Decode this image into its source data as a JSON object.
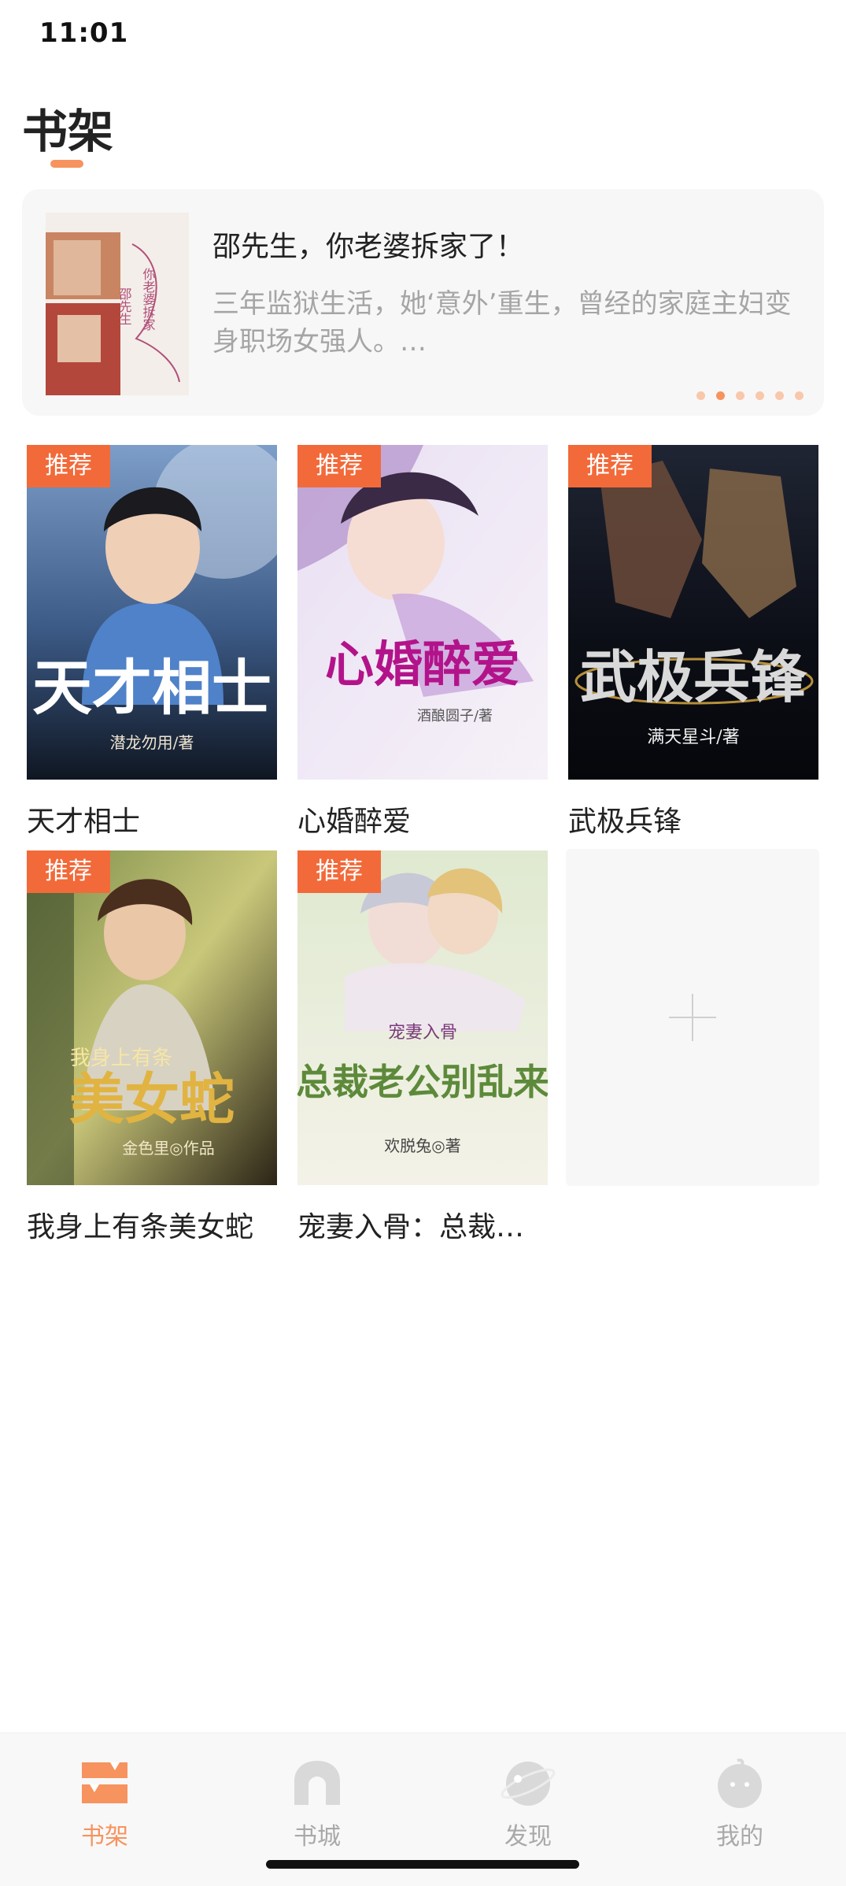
{
  "status_bar": {
    "time": "11:01"
  },
  "header": {
    "title": "书架"
  },
  "banner": {
    "title": "邵先生，你老婆拆家了！",
    "description": "三年监狱生活，她‘意外’重生，曾经的家庭主妇变身职场女强人。…",
    "cover_text": "邵先生 你老婆拆家了",
    "dots": 6,
    "active_dot": 1
  },
  "books": [
    {
      "title": "天才相士",
      "tag": "推荐",
      "cover_title": "天才相士",
      "cover_author": "潜龙勿用/著"
    },
    {
      "title": "心婚醉爱",
      "tag": "推荐",
      "cover_title": "心婚醉爱",
      "cover_author": "酒酿圆子/著"
    },
    {
      "title": "武极兵锋",
      "tag": "推荐",
      "cover_title": "武极兵锋",
      "cover_author": "满天星斗/著"
    },
    {
      "title": "我身上有条美女蛇",
      "tag": "推荐",
      "cover_title": "美女蛇",
      "cover_subtitle": "我身上有条",
      "cover_author": "金色里◎作品"
    },
    {
      "title": "宠妻入骨：总裁…",
      "tag": "推荐",
      "cover_title": "总裁老公别乱来",
      "cover_subtitle": "宠妻入骨",
      "cover_author": "欢脱兔◎著"
    }
  ],
  "add_card": {
    "icon": "plus-icon"
  },
  "tabbar": {
    "items": [
      {
        "label": "书架",
        "icon": "bookshelf-icon",
        "active": true
      },
      {
        "label": "书城",
        "icon": "bookstore-icon",
        "active": false
      },
      {
        "label": "发现",
        "icon": "discover-icon",
        "active": false
      },
      {
        "label": "我的",
        "icon": "profile-icon",
        "active": false
      }
    ]
  },
  "colors": {
    "accent": "#f7935e",
    "tag": "#f26a3a",
    "inactive": "#a9a9a9"
  }
}
